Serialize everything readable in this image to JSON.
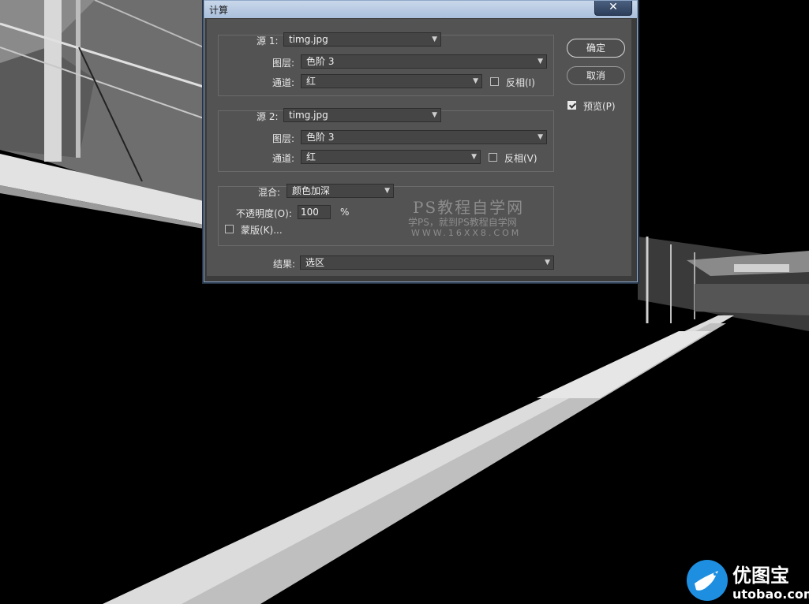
{
  "dialog": {
    "title": "计算",
    "close_icon": "close-icon",
    "source1": {
      "label": "源 1:",
      "file": "timg.jpg",
      "layer_label": "图层:",
      "layer": "色阶 3",
      "channel_label": "通道:",
      "channel": "红",
      "invert_label": "反相(I)",
      "invert_checked": false
    },
    "source2": {
      "label": "源 2:",
      "file": "timg.jpg",
      "layer_label": "图层:",
      "layer": "色阶 3",
      "channel_label": "通道:",
      "channel": "红",
      "invert_label": "反相(V)",
      "invert_checked": false
    },
    "blend": {
      "label": "混合:",
      "mode": "颜色加深",
      "opacity_label": "不透明度(O):",
      "opacity": "100",
      "opacity_unit": "%",
      "mask_label": "蒙版(K)...",
      "mask_checked": false
    },
    "result": {
      "label": "结果:",
      "value": "选区"
    },
    "buttons": {
      "ok": "确定",
      "cancel": "取消"
    },
    "preview": {
      "label": "预览(P)",
      "checked": true
    }
  },
  "watermark": {
    "line1": "PS教程自学网",
    "line2": "学PS，就到PS教程自学网",
    "line3": "WWW.16XX8.COM"
  },
  "site_logo": {
    "name": "优图宝",
    "domain": "utobao.com",
    "icon": "bird-icon"
  },
  "colors": {
    "dialog_bg": "#535353",
    "titlebar": "#b8cae2",
    "close_button": "#34486a",
    "logo_blue": "#1e8fe0"
  }
}
